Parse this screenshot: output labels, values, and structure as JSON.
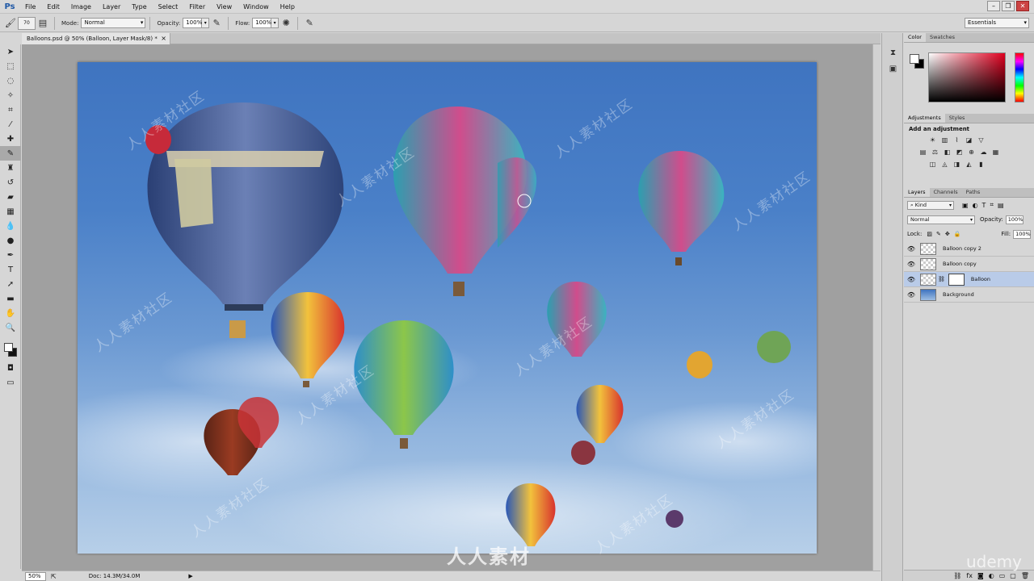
{
  "app": {
    "logo": "Ps"
  },
  "menu": [
    "File",
    "Edit",
    "Image",
    "Layer",
    "Type",
    "Select",
    "Filter",
    "View",
    "Window",
    "Help"
  ],
  "options_bar": {
    "brush_size": "70",
    "mode_label": "Mode:",
    "mode_value": "Normal",
    "opacity_label": "Opacity:",
    "opacity_value": "100%",
    "flow_label": "Flow:",
    "flow_value": "100%",
    "workspace": "Essentials"
  },
  "document": {
    "tab_title": "Balloons.psd @ 50% (Balloon, Layer Mask/8) *",
    "close_glyph": "×"
  },
  "status": {
    "zoom": "50%",
    "doc_info": "Doc: 14.3M/34.0M",
    "arrow": "▶"
  },
  "panels": {
    "color_tabs": [
      "Color",
      "Swatches"
    ],
    "adjust_tabs": [
      "Adjustments",
      "Styles"
    ],
    "adjust_title": "Add an adjustment",
    "layers_tabs": [
      "Layers",
      "Channels",
      "Paths"
    ],
    "kind_label": "Kind",
    "blend_mode": "Normal",
    "opacity_label": "Opacity:",
    "opacity_value": "100%",
    "lock_label": "Lock:",
    "fill_label": "Fill:",
    "fill_value": "100%",
    "layers": [
      {
        "name": "Balloon copy 2",
        "visible": true,
        "selected": false,
        "mask": false
      },
      {
        "name": "Balloon copy",
        "visible": true,
        "selected": false,
        "mask": false
      },
      {
        "name": "Balloon",
        "visible": true,
        "selected": true,
        "mask": true
      },
      {
        "name": "Background",
        "visible": true,
        "selected": false,
        "mask": false
      }
    ]
  },
  "watermarks": {
    "site_text": "人人素材社区",
    "logo_text": "人人素材",
    "udemy": "udemy"
  },
  "colors": {
    "foreground": "#ffffff",
    "background": "#000000",
    "selected_layer": "#b9cbe8",
    "sky_top": "#3f74c0"
  }
}
